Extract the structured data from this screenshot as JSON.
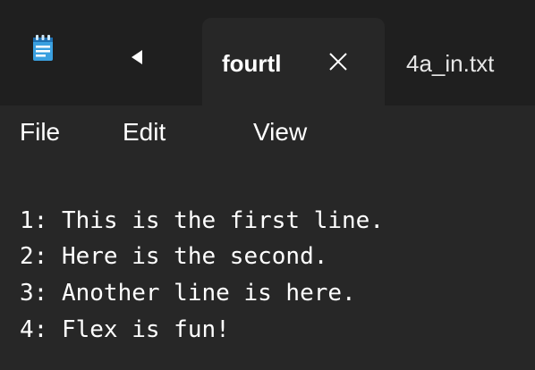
{
  "window": {
    "app_icon": "notepad-icon",
    "back_icon": "scroll-tabs-left-icon",
    "tabs": [
      {
        "label": "fourtl",
        "active": true,
        "close_icon": "close-icon"
      },
      {
        "label": "4a_in.txt",
        "active": false
      }
    ]
  },
  "menu": {
    "items": [
      "File",
      "Edit",
      "View"
    ]
  },
  "editor": {
    "lines": [
      "1: This is the first line.",
      "2: Here is the second.",
      "3: Another line is here.",
      "4: Flex is fun!"
    ]
  },
  "colors": {
    "titlebar_bg": "#1f1f1f",
    "window_bg": "#272727",
    "text": "#ffffff",
    "icon_accent": "#3aa0e0"
  }
}
